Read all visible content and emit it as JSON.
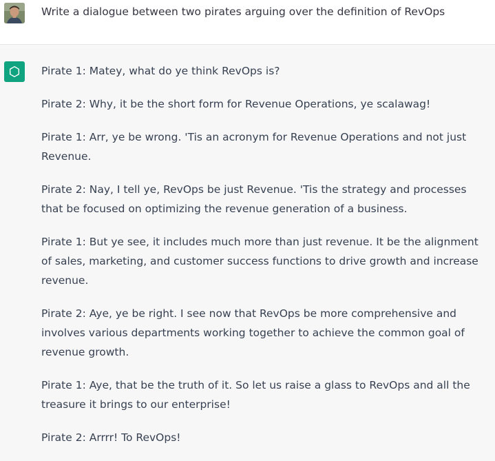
{
  "prompt": {
    "text": "Write a dialogue between two pirates arguing over the definition of RevOps"
  },
  "response": {
    "paragraphs": [
      "Pirate 1: Matey, what do ye think RevOps is?",
      "Pirate 2: Why, it be the short form for Revenue Operations, ye scalawag!",
      "Pirate 1: Arr, ye be wrong. 'Tis an acronym for Revenue Operations and not just Revenue.",
      "Pirate 2: Nay, I tell ye, RevOps be just Revenue. 'Tis the strategy and processes that be focused on optimizing the revenue generation of a business.",
      "Pirate 1: But ye see, it includes much more than just revenue. It be the alignment of sales, marketing, and customer success functions to drive growth and increase revenue.",
      "Pirate 2: Aye, ye be right. I see now that RevOps be more comprehensive and involves various departments working together to achieve the common goal of revenue growth.",
      "Pirate 1: Aye, that be the truth of it. So let us raise a glass to RevOps and all the treasure it brings to our enterprise!",
      "Pirate 2: Arrrr! To RevOps!"
    ]
  },
  "icons": {
    "user_avatar": "user-avatar-icon",
    "assistant_avatar": "openai-logo-icon"
  },
  "colors": {
    "assistant_accent": "#10a37f",
    "assistant_bg": "#f7f7f8",
    "user_bg": "#ffffff",
    "text": "#374151"
  }
}
